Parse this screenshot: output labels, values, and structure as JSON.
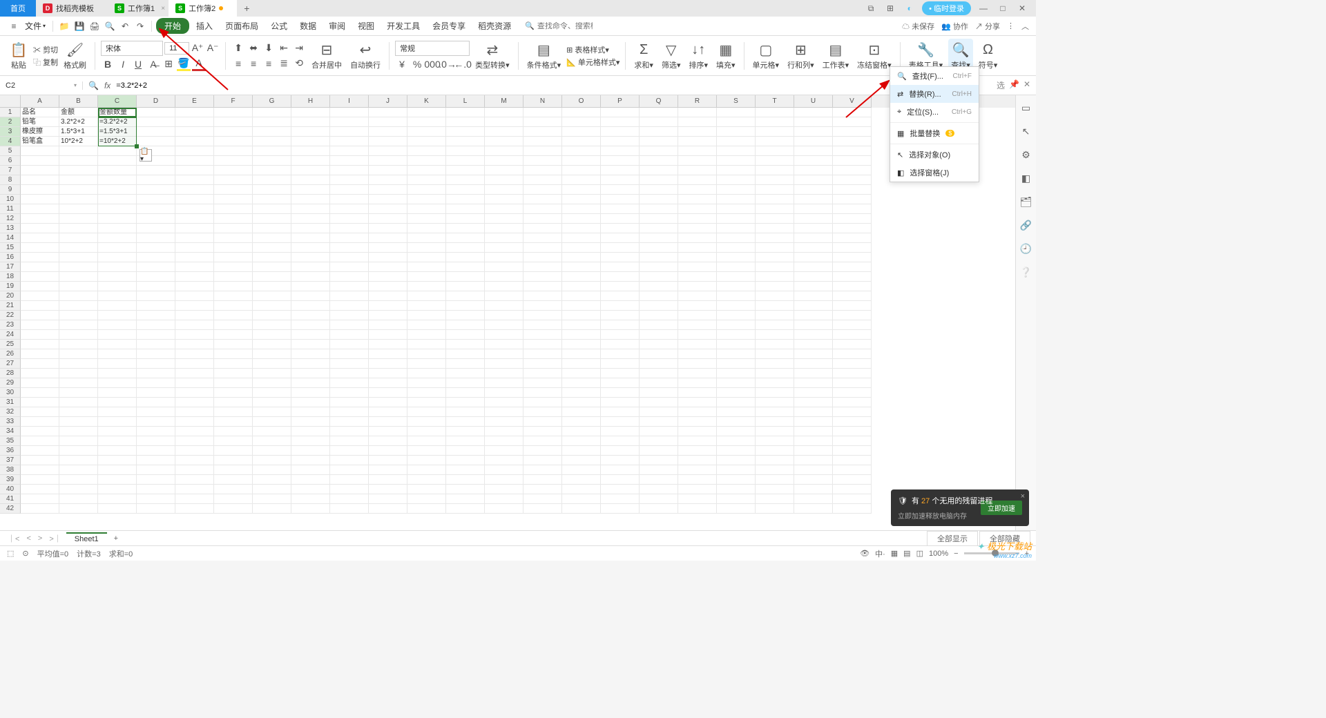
{
  "tabs": {
    "home": "首页",
    "t1": "找稻壳模板",
    "t2": "工作簿1",
    "t3": "工作簿2"
  },
  "titlebar": {
    "login": "临时登录"
  },
  "menubar": {
    "file": "文件",
    "tabs": [
      "开始",
      "插入",
      "页面布局",
      "公式",
      "数据",
      "审阅",
      "视图",
      "开发工具",
      "会员专享",
      "稻壳资源"
    ],
    "search_placeholder": "查找命令、搜索模板",
    "unsaved": "未保存",
    "collab": "协作",
    "share": "分享"
  },
  "ribbon": {
    "paste": "粘贴",
    "cut": "剪切",
    "copy": "复制",
    "format_painter": "格式刷",
    "font_name": "宋体",
    "font_size": "11",
    "merge": "合并居中",
    "wrap": "自动换行",
    "number_format": "常规",
    "type_convert": "类型转换",
    "cond_format": "条件格式",
    "cell_style": "单元格样式",
    "table_style": "表格样式",
    "sum": "求和",
    "filter": "筛选",
    "sort": "排序",
    "fill": "填充",
    "cell": "单元格",
    "row_col": "行和列",
    "sheet": "工作表",
    "freeze": "冻结窗格",
    "tools": "表格工具",
    "find": "查找",
    "symbol": "符号"
  },
  "formula": {
    "cell_ref": "C2",
    "fx": "fx",
    "value": "=3.2*2+2"
  },
  "columns": [
    "A",
    "B",
    "C",
    "D",
    "E",
    "F",
    "G",
    "H",
    "I",
    "J",
    "K",
    "L",
    "M",
    "N",
    "O",
    "P",
    "Q",
    "R",
    "S",
    "T",
    "U",
    "V"
  ],
  "data_rows": [
    {
      "A": "品名",
      "B": "金额",
      "C": "金额数量"
    },
    {
      "A": "铅笔",
      "B": "3.2*2+2",
      "C": "=3.2*2+2"
    },
    {
      "A": "橡皮擦",
      "B": "1.5*3+1",
      "C": "=1.5*3+1"
    },
    {
      "A": "铅笔盒",
      "B": "10*2+2",
      "C": "=10*2+2"
    }
  ],
  "dropdown": {
    "find": "查找(F)...",
    "find_sc": "Ctrl+F",
    "replace": "替换(R)...",
    "replace_sc": "Ctrl+H",
    "goto": "定位(S)...",
    "goto_sc": "Ctrl+G",
    "batch": "批量替换",
    "sel_obj": "选择对象(O)",
    "sel_pane": "选择窗格(J)"
  },
  "panel_label": "选",
  "toast": {
    "title_pre": "有 ",
    "count": "27",
    "title_post": " 个无用的残留进程",
    "sub": "立即加速释放电脑内存",
    "btn": "立即加速"
  },
  "sheetbar": {
    "sheet": "Sheet1",
    "show_all": "全部显示",
    "hide_all": "全部隐藏"
  },
  "statusbar": {
    "avg": "平均值=0",
    "count": "计数=3",
    "sum": "求和=0",
    "zoom": "100%"
  },
  "watermark": {
    "brand": "极光下载站",
    "url": "www.xz7.com"
  }
}
